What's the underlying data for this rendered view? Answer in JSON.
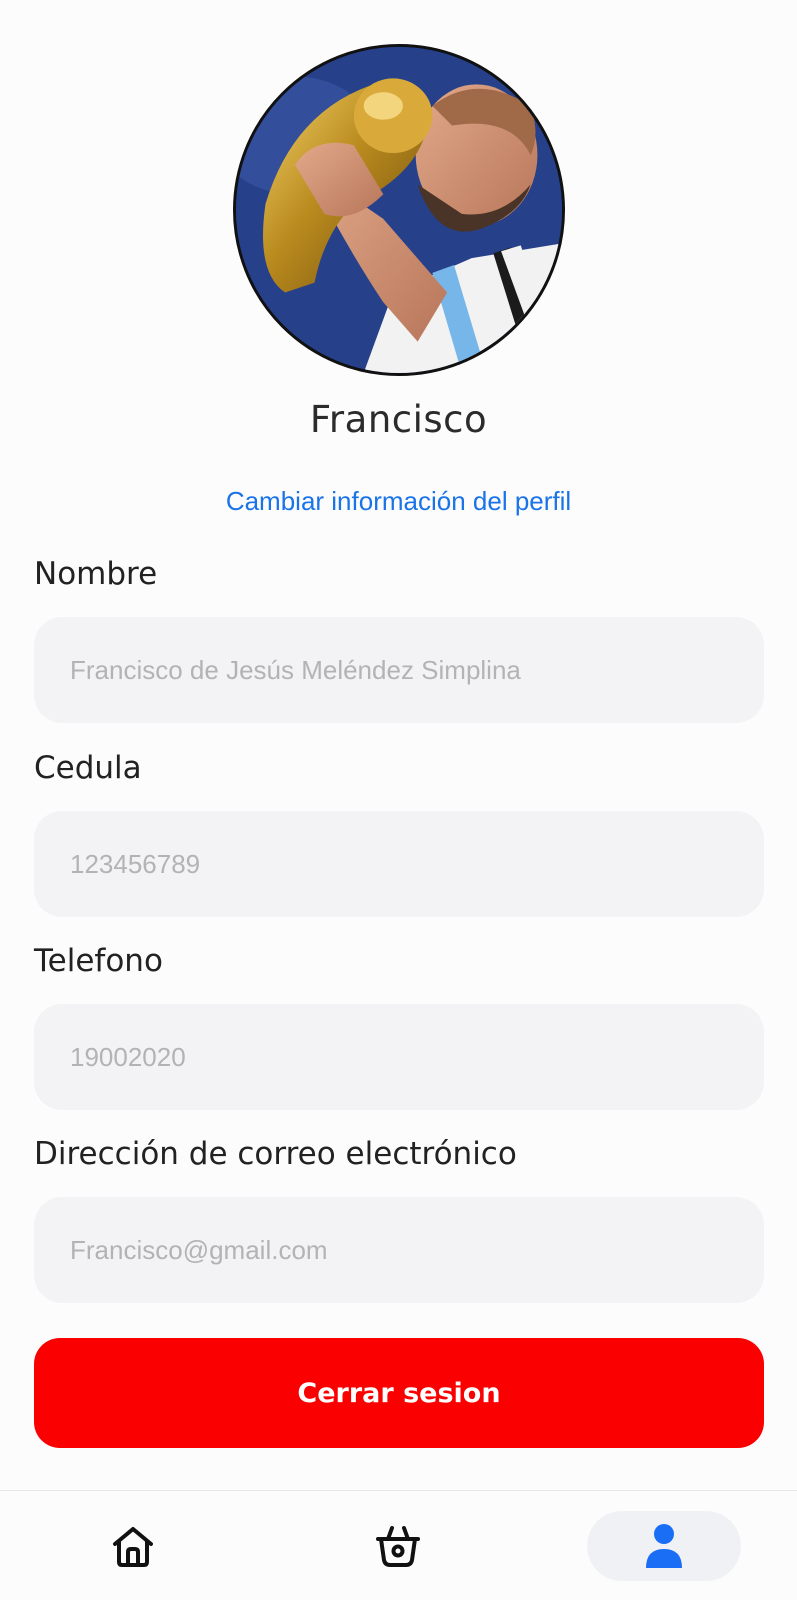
{
  "profile": {
    "name": "Francisco",
    "edit_link": "Cambiar información del perfil"
  },
  "fields": {
    "nombre": {
      "label": "Nombre",
      "placeholder": "Francisco de Jesús Meléndez Simplina"
    },
    "cedula": {
      "label": "Cedula",
      "placeholder": "123456789"
    },
    "telefono": {
      "label": "Telefono",
      "placeholder": "19002020"
    },
    "correo": {
      "label": "Dirección de correo electrónico",
      "placeholder": "Francisco@gmail.com"
    }
  },
  "logout": {
    "label": "Cerrar sesion"
  },
  "nav": {
    "items": [
      {
        "icon": "home-icon",
        "active": false
      },
      {
        "icon": "basket-icon",
        "active": false
      },
      {
        "icon": "user-icon",
        "active": true
      }
    ]
  },
  "colors": {
    "accent_link": "#1a73e8",
    "logout_button": "#fa0000",
    "active_nav_icon": "#1a6ef5",
    "field_background": "#f3f3f5"
  }
}
